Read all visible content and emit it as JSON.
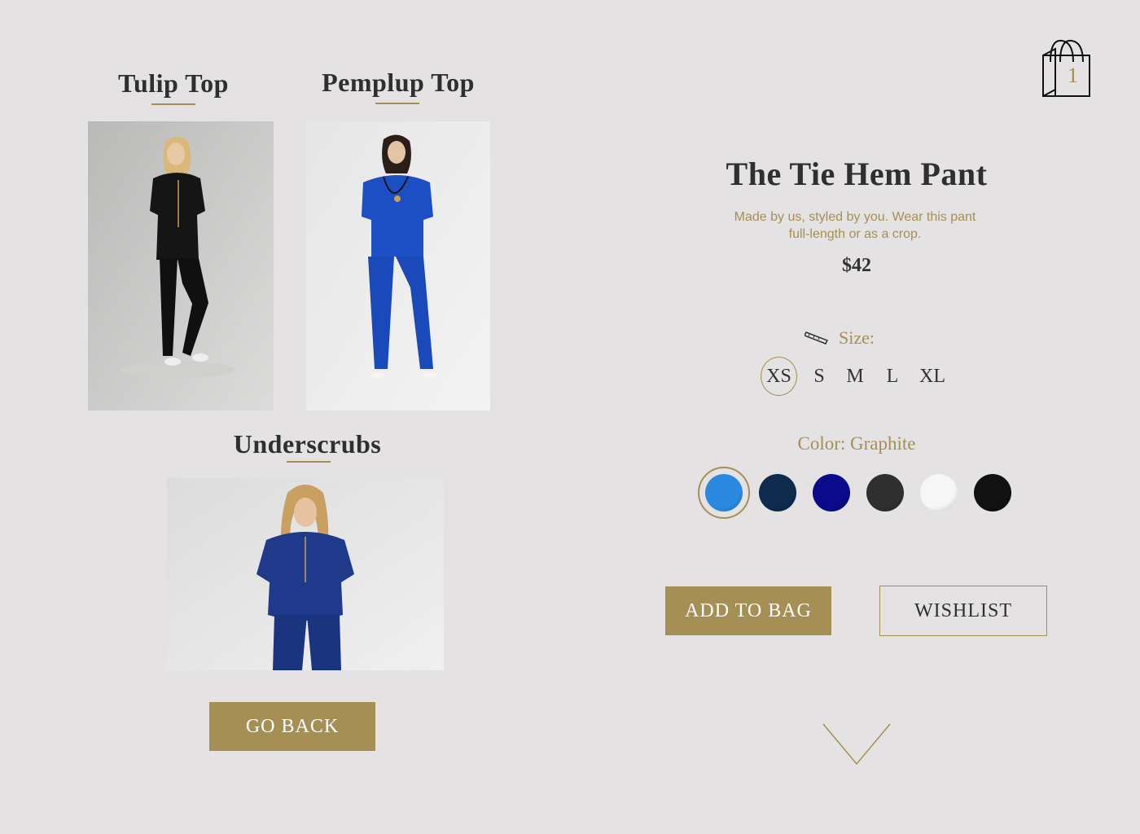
{
  "products": [
    {
      "title": "Tulip Top"
    },
    {
      "title": "Pemplup Top"
    },
    {
      "title": "Underscrubs"
    }
  ],
  "go_back_label": "GO BACK",
  "cart": {
    "count": "1"
  },
  "detail": {
    "name": "The Tie Hem Pant",
    "description_line1": "Made by us, styled by you. Wear this pant",
    "description_line2": "full-length or as a crop.",
    "price": "$42",
    "size_label": "Size:",
    "sizes": [
      "XS",
      "S",
      "M",
      "L",
      "XL"
    ],
    "selected_size": "XS",
    "color_label": "Color: Graphite",
    "swatches": [
      "#2b8ae0",
      "#0e2a4d",
      "#0a0a8a",
      "#2f2f2f",
      "#f6f6f6",
      "#111111"
    ],
    "add_to_bag_label": "ADD TO BAG",
    "wishlist_label": "WISHLIST"
  },
  "colors": {
    "accent": "#a68f55",
    "background": "#e4e2e2"
  }
}
